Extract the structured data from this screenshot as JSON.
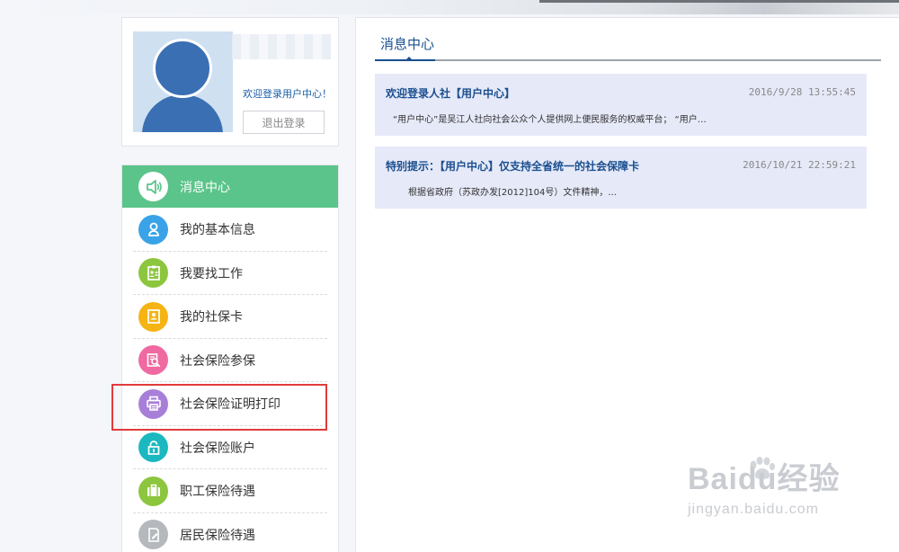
{
  "user": {
    "welcome": "欢迎登录用户中心！",
    "logout_label": "退出登录"
  },
  "menu": {
    "items": [
      {
        "label": "消息中心",
        "icon": "speaker-icon",
        "color": "#5bc48a",
        "active": true
      },
      {
        "label": "我的基本信息",
        "icon": "person-icon",
        "color": "#3aa3e8"
      },
      {
        "label": "我要找工作",
        "icon": "id-card-icon",
        "color": "#8cc63e"
      },
      {
        "label": "我的社保卡",
        "icon": "card-icon",
        "color": "#f5b414"
      },
      {
        "label": "社会保险参保",
        "icon": "search-doc-icon",
        "color": "#ef6aa0"
      },
      {
        "label": "社会保险证明打印",
        "icon": "printer-icon",
        "color": "#a77fd8"
      },
      {
        "label": "社会保险账户",
        "icon": "lock-icon",
        "color": "#1bb8c0"
      },
      {
        "label": "职工保险待遇",
        "icon": "briefcase-icon",
        "color": "#8cc63e"
      },
      {
        "label": "居民保险待遇",
        "icon": "edit-doc-icon",
        "color": "#b5b8bd"
      }
    ]
  },
  "content": {
    "tab_label": "消息中心",
    "messages": [
      {
        "title": "欢迎登录人社【用户中心】",
        "time": "2016/9/28 13:55:45",
        "snippet": "“用户中心”是吴江人社向社会公众个人提供网上便民服务的权威平台；  “用户…"
      },
      {
        "title": "特别提示：【用户中心】仅支持全省统一的社会保障卡",
        "time": "2016/10/21 22:59:21",
        "snippet": "根据省政府（苏政办发[2012]104号）文件精神，..."
      }
    ]
  },
  "watermark": {
    "brand": "Baidu经验",
    "url": "jingyan.baidu.com"
  }
}
